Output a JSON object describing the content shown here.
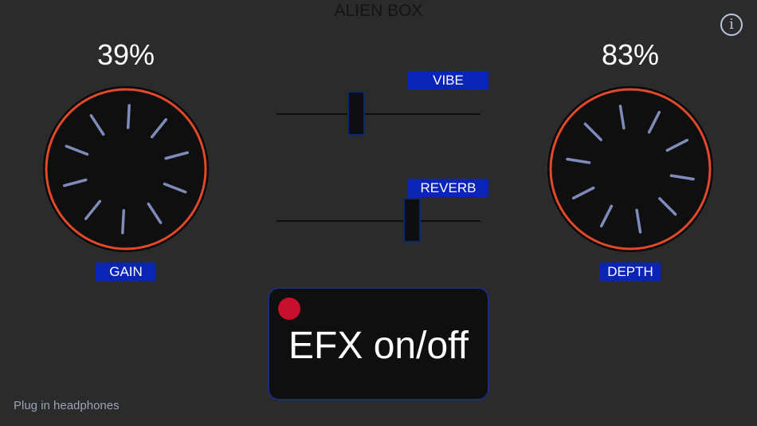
{
  "app": {
    "title": "ALIEN BOX",
    "info_icon": "info-icon",
    "info_glyph": "i"
  },
  "gain": {
    "percent_label": "39%",
    "value": 0.39,
    "label": "GAIN"
  },
  "depth": {
    "percent_label": "83%",
    "value": 0.83,
    "label": "DEPTH"
  },
  "vibe": {
    "label": "VIBE",
    "value": 0.38
  },
  "reverb": {
    "label": "REVERB",
    "value": 0.68
  },
  "efx": {
    "label": "EFX on/off",
    "active": true
  },
  "status": {
    "text": "Plug in headphones"
  },
  "colors": {
    "background": "#2b2b2b",
    "knob_ring": "#e2482a",
    "knob_face": "#0f0f10",
    "tick": "#7f8bb8",
    "tag_bg": "#0a24b8",
    "record_dot": "#c8102e"
  }
}
